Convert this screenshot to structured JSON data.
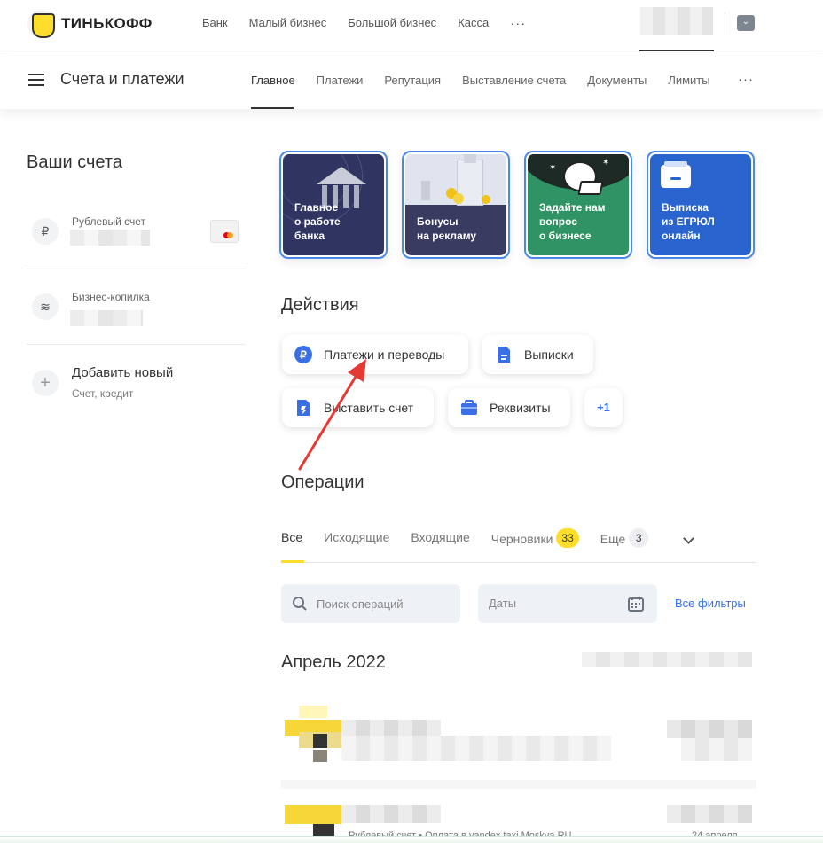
{
  "topbar": {
    "logo_text": "ТИНЬКОФФ",
    "nav": [
      "Банк",
      "Малый бизнес",
      "Большой бизнес",
      "Касса"
    ],
    "more": "···"
  },
  "subbar": {
    "title": "Счета и платежи",
    "tabs": [
      "Главное",
      "Платежи",
      "Репутация",
      "Выставление счета",
      "Документы",
      "Лимиты"
    ],
    "more": "···"
  },
  "accounts": {
    "title": "Ваши счета",
    "items": [
      {
        "name": "Рублевый счет",
        "icon": "ruble-icon"
      },
      {
        "name": "Бизнес-копилка",
        "icon": "coins-icon"
      }
    ],
    "add": {
      "title": "Добавить новый",
      "subtitle": "Счет, кредит"
    }
  },
  "stories": [
    {
      "lines": [
        "Главное",
        "о работе",
        "банка"
      ],
      "color": "#2f3461"
    },
    {
      "lines": [
        "Бонусы",
        "на рекламу"
      ],
      "color": "#3a3b61"
    },
    {
      "lines": [
        "Задайте нам",
        "вопрос",
        "о бизнесе"
      ],
      "color": "#2f9365"
    },
    {
      "lines": [
        "Выписка",
        "из ЕГРЮЛ",
        "онлайн"
      ],
      "color": "#2a64cf"
    }
  ],
  "actions": {
    "title": "Действия",
    "buttons": [
      "Платежи и переводы",
      "Выписки",
      "Выставить счет",
      "Реквизиты"
    ],
    "more": "+1"
  },
  "operations": {
    "title": "Операции",
    "tabs": {
      "all": "Все",
      "outgoing": "Исходящие",
      "incoming": "Входящие",
      "drafts": "Черновики",
      "drafts_count": "33",
      "more": "Еще",
      "more_count": "3"
    },
    "search_placeholder": "Поиск операций",
    "dates_label": "Даты",
    "filters_link": "Все фильтры",
    "month": "Апрель 2022",
    "tx_meta": "Рублевый счет  •  Оплата в yandex taxi Moskva RU",
    "tx_date": "24 апреля"
  },
  "colors": {
    "accent": "#ffdd2d",
    "link": "#336fee",
    "annotation_arrow": "#e53935"
  }
}
